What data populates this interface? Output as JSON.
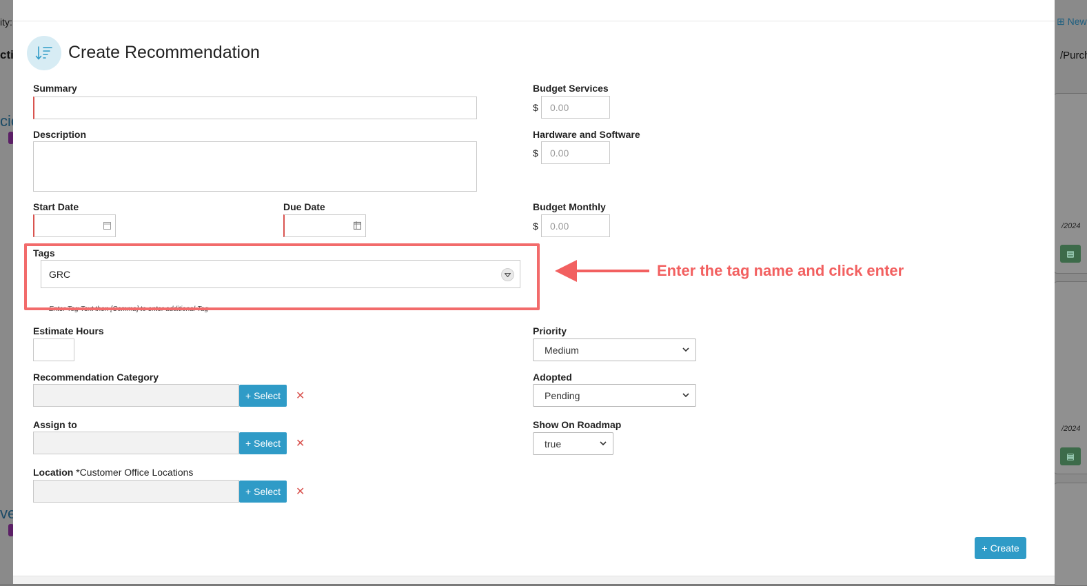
{
  "background": {
    "left_texts": [
      "ity:",
      "ctio",
      "cio",
      "ve"
    ],
    "right_texts": [
      "/Purcha"
    ],
    "new_button": "New",
    "dates": [
      "/2024",
      "/2024"
    ]
  },
  "modal": {
    "title": "Create Recommendation",
    "icon": "sort-list-icon",
    "summary": {
      "label": "Summary",
      "value": ""
    },
    "description": {
      "label": "Description",
      "value": ""
    },
    "start_date": {
      "label": "Start Date",
      "value": ""
    },
    "due_date": {
      "label": "Due Date",
      "value": ""
    },
    "tags": {
      "label": "Tags",
      "value": "GRC",
      "hint": "Enter Tag Text then [Comma] to enter additional Tag"
    },
    "estimate_hours": {
      "label": "Estimate Hours",
      "value": ""
    },
    "recommendation_category": {
      "label": "Recommendation Category",
      "select_label": "Select"
    },
    "assign_to": {
      "label": "Assign to",
      "select_label": "Select"
    },
    "location": {
      "label": "Location",
      "note": "*Customer Office Locations",
      "select_label": "Select"
    },
    "budget_services": {
      "label": "Budget Services",
      "currency": "$",
      "placeholder": "0.00"
    },
    "hardware_software": {
      "label": "Hardware and Software",
      "currency": "$",
      "placeholder": "0.00"
    },
    "budget_monthly": {
      "label": "Budget Monthly",
      "currency": "$",
      "placeholder": "0.00"
    },
    "priority": {
      "label": "Priority",
      "value": "Medium"
    },
    "adopted": {
      "label": "Adopted",
      "value": "Pending"
    },
    "show_on_roadmap": {
      "label": "Show On Roadmap",
      "value": "true"
    },
    "create_label": "Create"
  },
  "annotation": {
    "text": "Enter the tag name and click enter",
    "color": "#f26060"
  },
  "colors": {
    "accent": "#2f9bc7",
    "required": "#d9534f",
    "highlight": "#f26b6b"
  }
}
